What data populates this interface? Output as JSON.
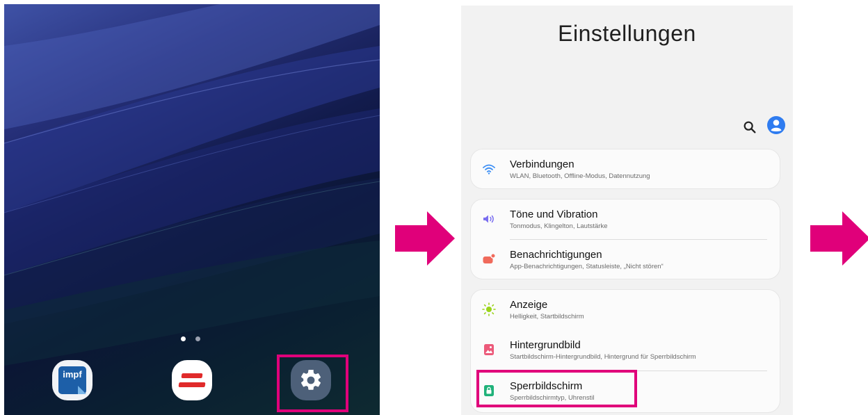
{
  "home": {
    "page_indicator": {
      "pages": 2,
      "current": 1
    },
    "dock": [
      {
        "name": "impf-app",
        "label": "impf",
        "icon": "impf-app-icon"
      },
      {
        "name": "news-app",
        "icon": "red-stripes-app-icon"
      },
      {
        "name": "settings-app",
        "icon": "gear-icon"
      }
    ]
  },
  "settings": {
    "title": "Einstellungen",
    "toolbar": {
      "search_icon": "search-icon",
      "profile_icon": "account-icon"
    },
    "groups": [
      {
        "items": [
          {
            "title": "Verbindungen",
            "subtitle": "WLAN, Bluetooth, Offline-Modus, Datennutzung",
            "icon": "wifi-icon",
            "color": "#3d8ff5"
          }
        ]
      },
      {
        "items": [
          {
            "title": "Töne und Vibration",
            "subtitle": "Tonmodus, Klingelton, Lautstärke",
            "icon": "speaker-icon",
            "color": "#7b6ff0"
          },
          {
            "title": "Benachrichtigungen",
            "subtitle": "App-Benachrichtigungen, Statusleiste, „Nicht stören“",
            "icon": "notification-icon",
            "color": "#f06a5b"
          }
        ]
      },
      {
        "items": [
          {
            "title": "Anzeige",
            "subtitle": "Helligkeit, Startbildschirm",
            "icon": "brightness-icon",
            "color": "#9ad31a"
          },
          {
            "title": "Hintergrundbild",
            "subtitle": "Startbildschirm-Hintergrundbild, Hintergrund für Sperrbildschirm",
            "icon": "wallpaper-icon",
            "color": "#ec5a7a"
          },
          {
            "title": "Sperrbildschirm",
            "subtitle": "Sperrbildschirmtyp, Uhrenstil",
            "icon": "lock-icon",
            "color": "#20b27a"
          }
        ]
      }
    ]
  },
  "colors": {
    "highlight": "#e0007a",
    "arrow": "#e0007a"
  }
}
